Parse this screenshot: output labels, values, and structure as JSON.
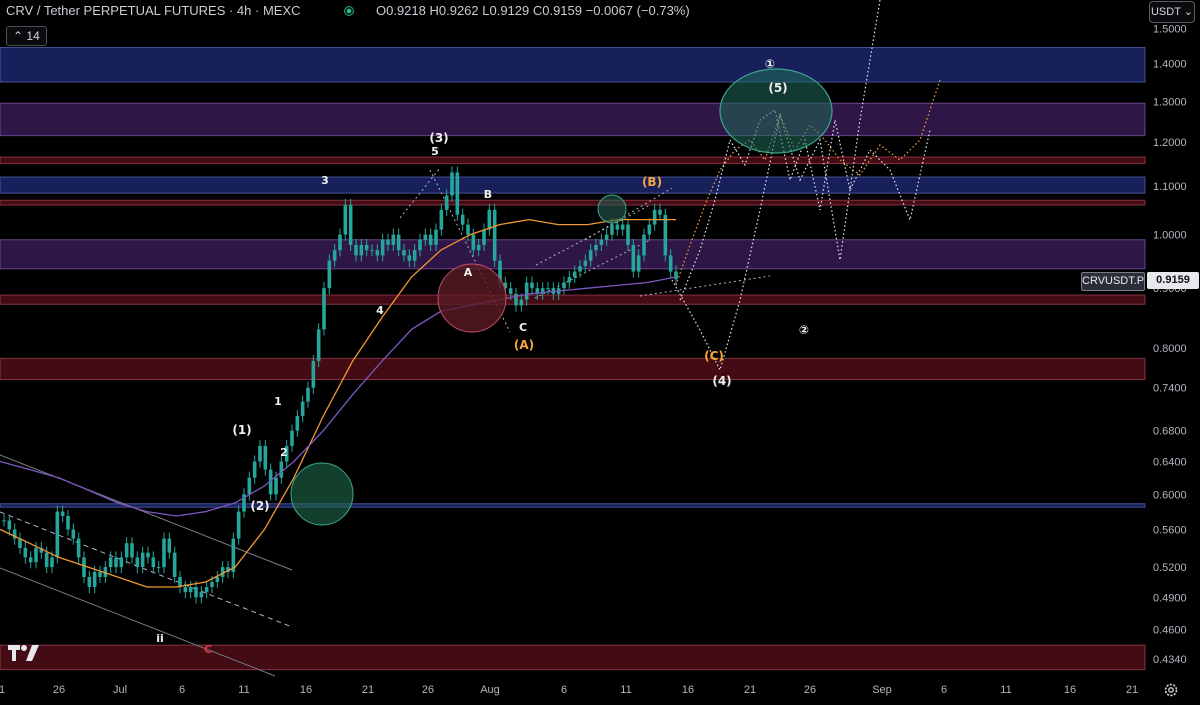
{
  "header": {
    "title": "CRV / Tether PERPETUAL FUTURES · 4h · MEXC",
    "ohlc": "O0.9218 H0.9262 L0.9129 C0.9159 −0.0067 (−0.73%)",
    "interval_badge": "14"
  },
  "currency_button": "USDT",
  "price_tag": {
    "symbol": "CRVUSDT.P",
    "price": "0.9159"
  },
  "colors": {
    "background": "#000000",
    "candle": "#26a69a",
    "ma_orange": "#f29736",
    "ma_purple": "#7e57c2",
    "zone_blue": "#1f2b78",
    "zone_purple": "#3d1d5e",
    "zone_red": "#5a0f1a",
    "wave_orange": "#f7a43b"
  },
  "chart_data": {
    "type": "candlestick",
    "y_scale": "log",
    "ylim": [
      0.425,
      1.52
    ],
    "y_ticks": [
      "1.5000",
      "1.4000",
      "1.3000",
      "1.2000",
      "1.1000",
      "1.0000",
      "0.9000",
      "0.8000",
      "0.7400",
      "0.6800",
      "0.6400",
      "0.6000",
      "0.5600",
      "0.5200",
      "0.4900",
      "0.4600",
      "0.4340"
    ],
    "y_tick_values": [
      1.5,
      1.4,
      1.3,
      1.2,
      1.1,
      1.0,
      0.9,
      0.8,
      0.74,
      0.68,
      0.64,
      0.6,
      0.56,
      0.52,
      0.49,
      0.46,
      0.434
    ],
    "x_ticks": [
      "1",
      "26",
      "Jul",
      "6",
      "11",
      "16",
      "21",
      "26",
      "Aug",
      "6",
      "11",
      "16",
      "21",
      "26",
      "Sep",
      "6",
      "11",
      "16",
      "21"
    ],
    "zones": [
      {
        "low": 1.35,
        "high": 1.445,
        "color": "blue"
      },
      {
        "low": 1.215,
        "high": 1.295,
        "color": "purple"
      },
      {
        "low": 1.15,
        "high": 1.165,
        "color": "red"
      },
      {
        "low": 1.085,
        "high": 1.12,
        "color": "blue"
      },
      {
        "low": 1.06,
        "high": 1.07,
        "color": "red"
      },
      {
        "low": 0.935,
        "high": 0.99,
        "color": "purple"
      },
      {
        "low": 0.872,
        "high": 0.888,
        "color": "red"
      },
      {
        "low": 0.752,
        "high": 0.784,
        "color": "red"
      },
      {
        "low": 0.585,
        "high": 0.589,
        "color": "blue"
      },
      {
        "low": 0.425,
        "high": 0.446,
        "color": "red"
      }
    ],
    "candles_close": [
      0.57,
      0.56,
      0.55,
      0.54,
      0.53,
      0.525,
      0.54,
      0.535,
      0.52,
      0.53,
      0.58,
      0.575,
      0.56,
      0.55,
      0.53,
      0.51,
      0.5,
      0.515,
      0.51,
      0.52,
      0.53,
      0.52,
      0.53,
      0.545,
      0.53,
      0.52,
      0.535,
      0.53,
      0.52,
      0.52,
      0.55,
      0.535,
      0.51,
      0.5,
      0.495,
      0.5,
      0.49,
      0.495,
      0.5,
      0.505,
      0.51,
      0.52,
      0.515,
      0.55,
      0.58,
      0.6,
      0.62,
      0.64,
      0.66,
      0.63,
      0.6,
      0.62,
      0.64,
      0.66,
      0.68,
      0.7,
      0.72,
      0.74,
      0.78,
      0.83,
      0.9,
      0.95,
      0.97,
      1.0,
      1.06,
      0.98,
      0.96,
      0.98,
      0.97,
      0.97,
      0.96,
      0.99,
      0.98,
      1.0,
      0.97,
      0.96,
      0.95,
      0.97,
      0.99,
      1.0,
      0.98,
      1.01,
      1.05,
      1.08,
      1.13,
      1.04,
      1.02,
      1.0,
      0.97,
      0.98,
      1.01,
      1.05,
      0.95,
      0.91,
      0.9,
      0.89,
      0.87,
      0.88,
      0.91,
      0.9,
      0.89,
      0.9,
      0.9,
      0.89,
      0.9,
      0.91,
      0.92,
      0.93,
      0.94,
      0.95,
      0.97,
      0.98,
      0.99,
      1.0,
      1.02,
      1.01,
      1.02,
      0.98,
      0.93,
      0.96,
      1.0,
      1.02,
      1.05,
      1.04,
      0.96,
      0.93,
      0.916
    ],
    "moving_averages": [
      {
        "color": "orange",
        "values": [
          0.56,
          0.545,
          0.53,
          0.52,
          0.51,
          0.5,
          0.5,
          0.505,
          0.52,
          0.56,
          0.62,
          0.7,
          0.78,
          0.85,
          0.92,
          0.97,
          1.0,
          1.02,
          1.03,
          1.02,
          1.02,
          1.03,
          1.03,
          1.03
        ]
      },
      {
        "color": "purple",
        "values": [
          0.64,
          0.63,
          0.62,
          0.605,
          0.59,
          0.58,
          0.575,
          0.58,
          0.59,
          0.61,
          0.64,
          0.68,
          0.73,
          0.78,
          0.83,
          0.86,
          0.87,
          0.88,
          0.89,
          0.895,
          0.9,
          0.905,
          0.91,
          0.92
        ]
      }
    ],
    "wave_labels": [
      {
        "text": "(3)",
        "color": "white"
      },
      {
        "text": "5",
        "color": "white"
      },
      {
        "text": "3",
        "color": "white"
      },
      {
        "text": "B",
        "color": "white"
      },
      {
        "text": "(B)",
        "color": "orange"
      },
      {
        "text": "①",
        "color": "white"
      },
      {
        "text": "(5)",
        "color": "white"
      },
      {
        "text": "A",
        "color": "white"
      },
      {
        "text": "C",
        "color": "white"
      },
      {
        "text": "(A)",
        "color": "orange"
      },
      {
        "text": "4",
        "color": "white"
      },
      {
        "text": "②",
        "color": "white"
      },
      {
        "text": "(C)",
        "color": "orange"
      },
      {
        "text": "(4)",
        "color": "white"
      },
      {
        "text": "1",
        "color": "white"
      },
      {
        "text": "(1)",
        "color": "white"
      },
      {
        "text": "2",
        "color": "white"
      },
      {
        "text": "(2)",
        "color": "white"
      },
      {
        "text": "ii",
        "color": "white"
      },
      {
        "text": "C",
        "color": "red"
      }
    ],
    "title": "CRV / Tether PERPETUAL FUTURES · 4h · MEXC"
  }
}
